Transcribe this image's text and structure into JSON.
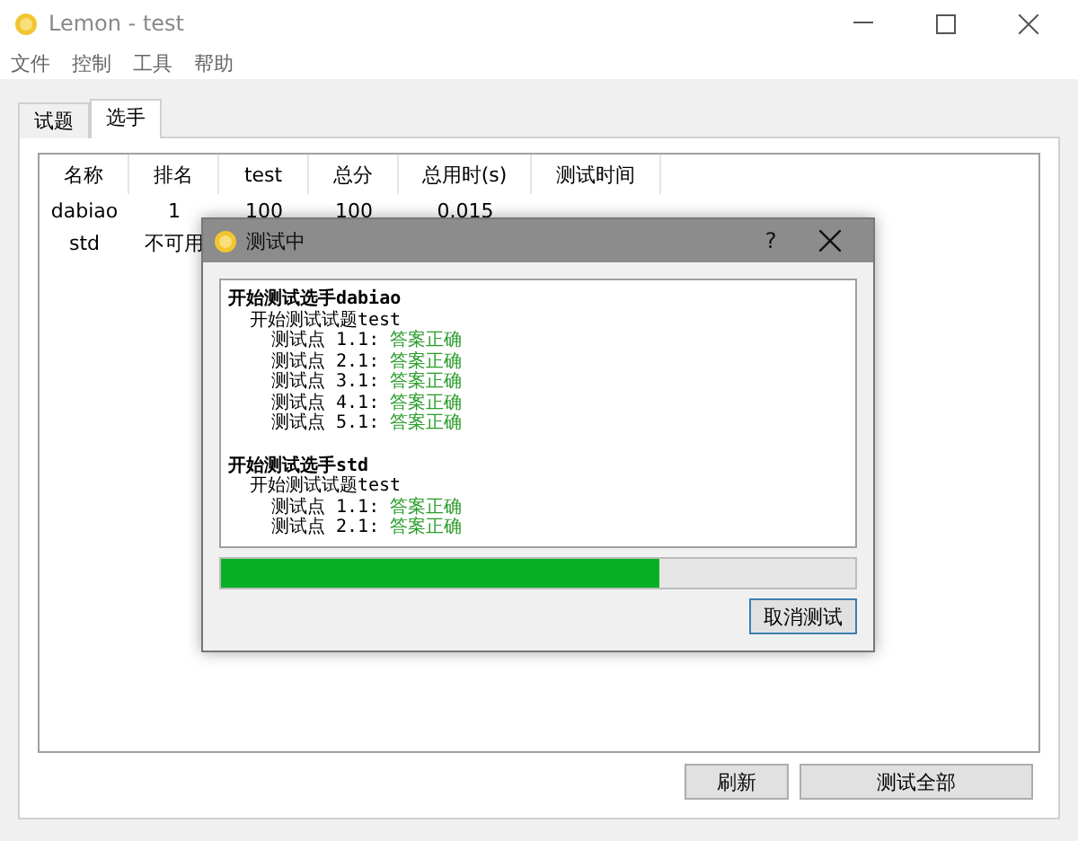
{
  "window": {
    "title": "Lemon - test"
  },
  "menu": [
    "文件",
    "控制",
    "工具",
    "帮助"
  ],
  "tabs": [
    {
      "label": "试题",
      "selected": false
    },
    {
      "label": "选手",
      "selected": true
    }
  ],
  "table": {
    "columns": [
      "名称",
      "排名",
      "test",
      "总分",
      "总用时(s)",
      "测试时间"
    ],
    "rows": [
      [
        "dabiao",
        "1",
        "100",
        "100",
        "0.015"
      ],
      [
        "std",
        "不可用"
      ]
    ]
  },
  "buttons": [
    "刷新",
    "测试全部"
  ],
  "dialog": {
    "title": "测试中",
    "help": "?",
    "log": [
      {
        "text": "开始测试选手dabiao",
        "children": [
          {
            "text": "开始测试试题test",
            "children": [
              {
                "label": "测试点 1.1:",
                "result": "答案正确"
              },
              {
                "label": "测试点 2.1:",
                "result": "答案正确"
              },
              {
                "label": "测试点 3.1:",
                "result": "答案正确"
              },
              {
                "label": "测试点 4.1:",
                "result": "答案正确"
              },
              {
                "label": "测试点 5.1:",
                "result": "答案正确"
              }
            ]
          }
        ]
      },
      {
        "text": "开始测试选手std",
        "children": [
          {
            "text": "开始测试试题test",
            "children": [
              {
                "label": "测试点 1.1:",
                "result": "答案正确"
              },
              {
                "label": "测试点 2.1:",
                "result": "答案正确"
              }
            ]
          }
        ]
      }
    ],
    "progress": {
      "level": 0.69
    },
    "cancel": "取消测试"
  }
}
